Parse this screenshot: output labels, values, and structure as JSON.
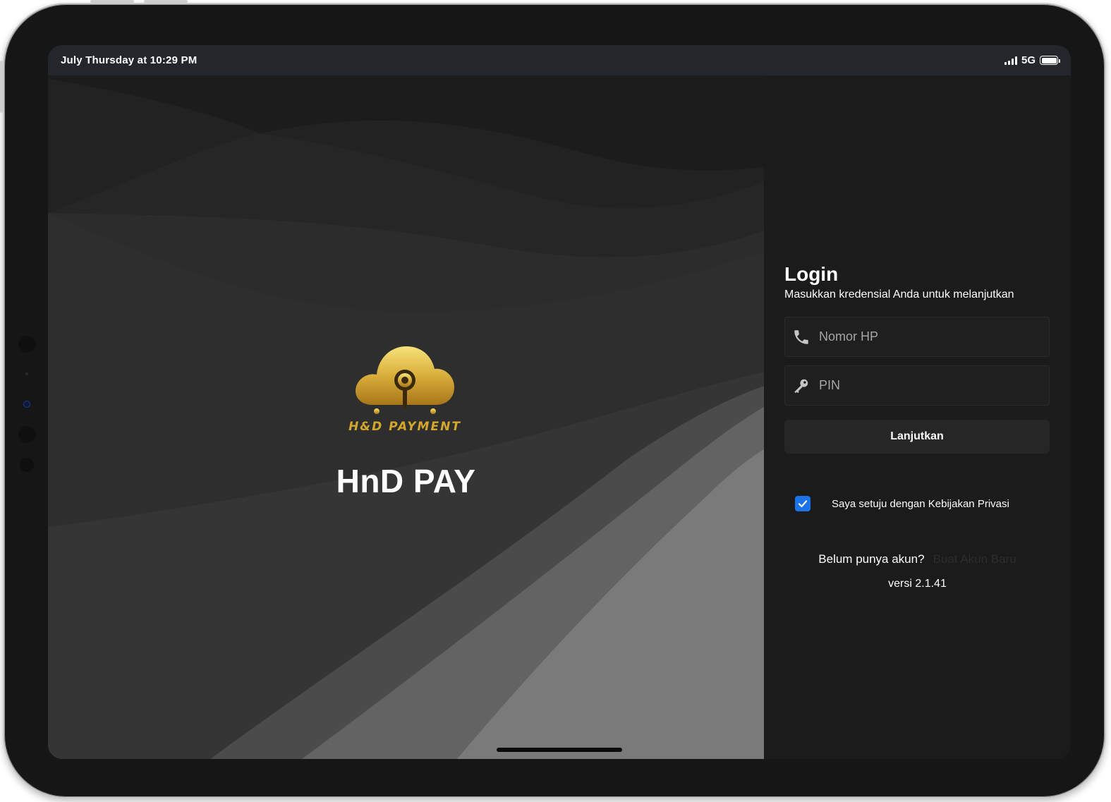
{
  "status_bar": {
    "time": "July Thursday at 10:29 PM",
    "network": "5G",
    "battery_level": 1.0
  },
  "hero": {
    "logo_text": "H&D PAYMENT",
    "app_name": "HnD PAY"
  },
  "login": {
    "title": "Login",
    "subtitle": "Masukkan kredensial Anda untuk melanjutkan",
    "phone_placeholder": "Nomor HP",
    "pin_placeholder": "PIN",
    "phone_icon": "phone-icon",
    "pin_icon": "key-icon",
    "continue_label": "Lanjutkan",
    "privacy_checked": true,
    "privacy_label": "Saya setuju dengan Kebijakan Privasi",
    "signup_prompt": "Belum punya akun?",
    "signup_link": "Buat Akun Baru",
    "version": "versi 2.1.41"
  },
  "colors": {
    "accent": "#1a73e8",
    "gold": "#d4a72c",
    "panel_bg": "#1b1b1b"
  }
}
